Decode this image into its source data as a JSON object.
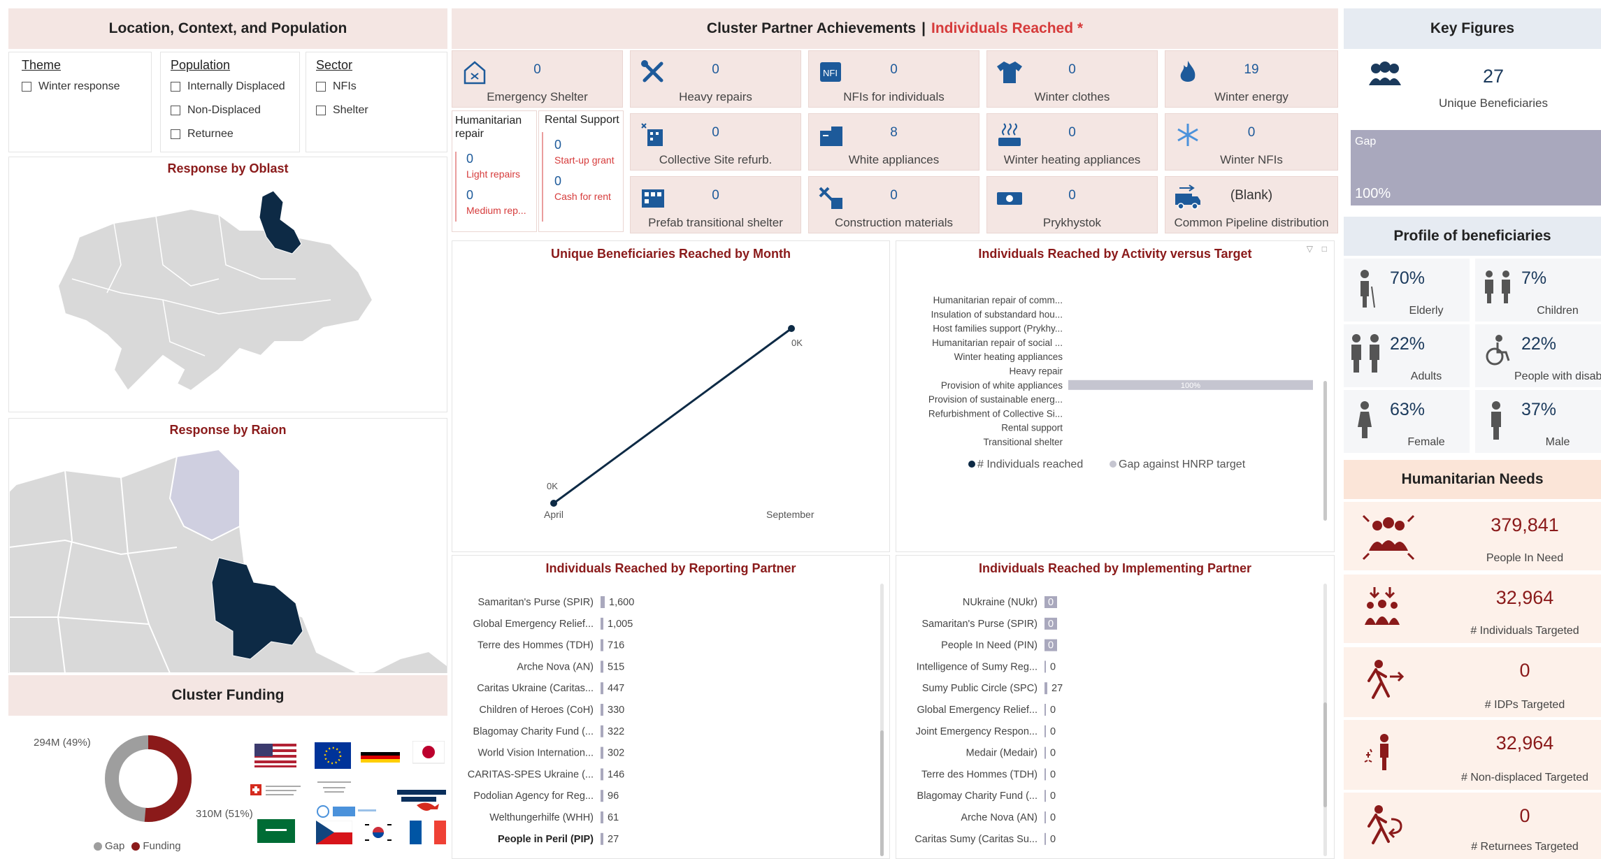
{
  "left": {
    "header": "Location, Context, and Population",
    "slicers": {
      "theme": {
        "title": "Theme",
        "items": [
          "Winter response"
        ]
      },
      "population": {
        "title": "Population",
        "items": [
          "Internally Displaced",
          "Non-Displaced",
          "Returnee"
        ]
      },
      "sector": {
        "title": "Sector",
        "items": [
          "NFIs",
          "Shelter"
        ]
      }
    },
    "oblast_title": "Response by Oblast",
    "raion_title": "Response by Raion",
    "funding": {
      "title": "Cluster Funding",
      "gap_label": "294M (49%)",
      "funding_label": "310M (51%)",
      "legend_gap": "Gap",
      "legend_funding": "Funding",
      "gap_value_m": 294,
      "funding_value_m": 310,
      "color_gap": "#9e9e9e",
      "color_funding": "#8b1a1a"
    }
  },
  "center": {
    "header_main": "Cluster Partner Achievements",
    "header_sep": "|",
    "header_accent": "Individuals Reached *",
    "tiles": [
      {
        "label": "Emergency Shelter",
        "value": "0",
        "icon": "house-icon"
      },
      {
        "label": "Heavy repairs",
        "value": "0",
        "icon": "tools-icon"
      },
      {
        "label": "NFIs for individuals",
        "value": "0",
        "icon": "nfi-icon"
      },
      {
        "label": "Winter clothes",
        "value": "0",
        "icon": "shirt-icon"
      },
      {
        "label": "Winter energy",
        "value": "19",
        "icon": "flame-icon"
      },
      {
        "label": "Collective Site refurb.",
        "value": "0",
        "icon": "building-icon"
      },
      {
        "label": "White appliances",
        "value": "8",
        "icon": "appliance-icon"
      },
      {
        "label": "Winter heating appliances",
        "value": "0",
        "icon": "heater-icon"
      },
      {
        "label": "Winter NFIs",
        "value": "0",
        "icon": "snowflake-icon"
      },
      {
        "label": "Prefab transitional shelter",
        "value": "0",
        "icon": "prefab-icon"
      },
      {
        "label": "Construction materials",
        "value": "0",
        "icon": "construction-icon"
      },
      {
        "label": "Prykhystok",
        "value": "0",
        "icon": "cash-icon"
      },
      {
        "label": "Common Pipeline distribution",
        "value": "(Blank)",
        "icon": "truck-icon"
      }
    ],
    "humanitarian_repair": {
      "title": "Humanitarian repair",
      "items": [
        {
          "value": "0",
          "label": "Light repairs"
        },
        {
          "value": "0",
          "label": "Medium rep..."
        }
      ]
    },
    "rental_support": {
      "title": "Rental Support",
      "items": [
        {
          "value": "0",
          "label": "Start-up grant"
        },
        {
          "value": "0",
          "label": "Cash for rent"
        }
      ]
    },
    "line_chart_title": "Unique Beneficiaries Reached by Month",
    "activity_chart_title": "Individuals Reached by Activity versus Target",
    "reporting_title": "Individuals Reached by Reporting Partner",
    "implementing_title": "Individuals Reached by Implementing Partner"
  },
  "chart_data": [
    {
      "type": "line",
      "title": "Unique Beneficiaries Reached by Month",
      "x": [
        "April",
        "September"
      ],
      "values": [
        0,
        0
      ],
      "data_labels": [
        "0K",
        "0K"
      ],
      "slope_shown": "rising"
    },
    {
      "type": "bar",
      "title": "Individuals Reached by Activity versus Target",
      "categories": [
        "Humanitarian repair of comm...",
        "Insulation of substandard hou...",
        "Host families support (Prykhy...",
        "Humanitarian repair of social ...",
        "Winter heating appliances",
        "Heavy repair",
        "Provision of white appliances",
        "Provision of sustainable energ...",
        "Refurbishment of Collective Si...",
        "Rental support",
        "Transitional shelter"
      ],
      "series": [
        {
          "name": "# Individuals reached",
          "values": [
            0,
            0,
            0,
            0,
            0,
            0,
            0,
            0,
            0,
            0,
            0
          ]
        },
        {
          "name": "Gap against HNRP target",
          "values": [
            0,
            0,
            0,
            0,
            0,
            0,
            100,
            0,
            0,
            0,
            0
          ]
        }
      ],
      "unit": "%",
      "data_label": "100%",
      "legend": "bottom",
      "colors": {
        "reached": "#0d2a45",
        "gap": "#c5c5d0"
      }
    },
    {
      "type": "bar",
      "title": "Individuals Reached by Reporting Partner",
      "categories": [
        "Samaritan's Purse (SPIR)",
        "Global Emergency Relief...",
        "Terre des Hommes (TDH)",
        "Arche Nova (AN)",
        "Caritas Ukraine (Caritas...",
        "Children of Heroes (CoH)",
        "Blagomay Charity Fund (...",
        "World Vision Internation...",
        "CARITAS-SPES Ukraine (...",
        "Podolian Agency for Reg...",
        "Welthungerhilfe (WHH)",
        "People in Peril (PIP)"
      ],
      "values": [
        1600,
        1005,
        716,
        515,
        447,
        330,
        322,
        302,
        146,
        96,
        61,
        27
      ],
      "labels": [
        "1,600",
        "1,005",
        "716",
        "515",
        "447",
        "330",
        "322",
        "302",
        "146",
        "96",
        "61",
        "27"
      ]
    },
    {
      "type": "bar",
      "title": "Individuals Reached by Implementing Partner",
      "categories": [
        "NUkraine (NUkr)",
        "Samaritan's Purse (SPIR)",
        "People In Need (PIN)",
        "Intelligence of Sumy Reg...",
        "Sumy Public Circle (SPC)",
        "Global Emergency Relief...",
        "Joint Emergency Respon...",
        "Medair (Medair)",
        "Terre des Hommes (TDH)",
        "Blagomay Charity Fund (...",
        "Arche Nova (AN)",
        "Caritas Sumy (Caritas Su..."
      ],
      "values": [
        0,
        0,
        0,
        0,
        27,
        0,
        0,
        0,
        0,
        0,
        0,
        0
      ],
      "labels": [
        "0",
        "0",
        "0",
        "0",
        "27",
        "0",
        "0",
        "0",
        "0",
        "0",
        "0",
        "0"
      ]
    },
    {
      "type": "pie",
      "title": "Cluster Funding",
      "categories": [
        "Gap",
        "Funding"
      ],
      "values": [
        294,
        310
      ],
      "labels": [
        "294M (49%)",
        "310M (51%)"
      ]
    }
  ],
  "right": {
    "key_figures_title": "Key Figures",
    "unique_beneficiaries_value": "27",
    "unique_beneficiaries_label": "Unique Beneficiaries",
    "gap_label": "Gap",
    "gap_pct": "100%",
    "profile_title": "Profile of beneficiaries",
    "profile": [
      {
        "pct": "70%",
        "label": "Elderly",
        "icon": "elderly-icon"
      },
      {
        "pct": "7%",
        "label": "Children",
        "icon": "children-icon"
      },
      {
        "pct": "22%",
        "label": "Adults",
        "icon": "adults-icon"
      },
      {
        "pct": "22%",
        "label": "People with disabiliti...",
        "icon": "wheelchair-icon"
      },
      {
        "pct": "63%",
        "label": "Female",
        "icon": "female-icon"
      },
      {
        "pct": "37%",
        "label": "Male",
        "icon": "male-icon"
      }
    ],
    "needs_title": "Humanitarian Needs",
    "needs": [
      {
        "value": "379,841",
        "label": "People In Need",
        "icon": "people-in-need-icon"
      },
      {
        "value": "32,964",
        "label": "# Individuals Targeted",
        "icon": "targeted-icon"
      },
      {
        "value": "0",
        "label": "# IDPs Targeted",
        "icon": "idp-icon"
      },
      {
        "value": "32,964",
        "label": "# Non-displaced Targeted",
        "icon": "non-displaced-icon"
      },
      {
        "value": "0",
        "label": "# Returnees Targeted",
        "icon": "returnee-icon"
      }
    ]
  },
  "colors": {
    "navy": "#0d2a45",
    "accent_red": "#d63b3b",
    "dark_red": "#8a1a1a",
    "tile_bg": "#f4e6e3",
    "map_grey": "#d9d9d9",
    "map_highlight": "#0d2a45",
    "map_light": "#cfcfe0"
  }
}
